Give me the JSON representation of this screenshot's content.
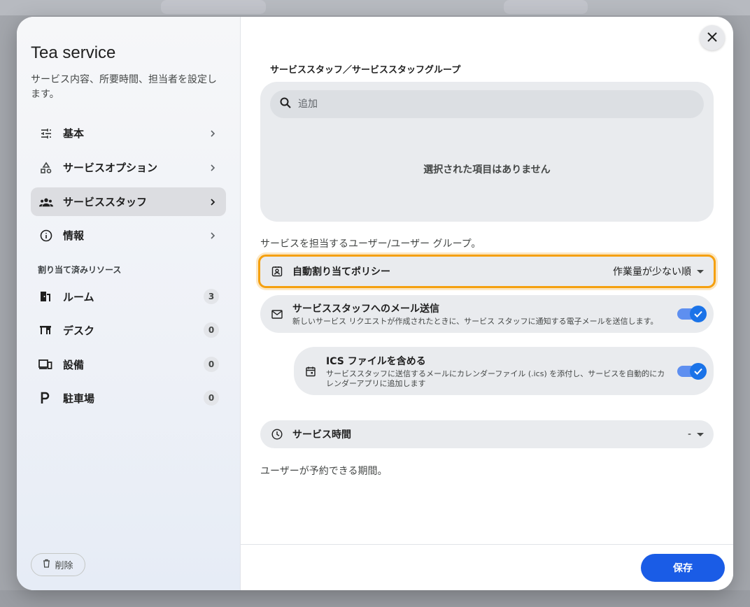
{
  "dialog": {
    "title": "Tea service",
    "description": "サービス内容、所要時間、担当者を設定します。"
  },
  "sidebar": {
    "nav": [
      {
        "label": "基本",
        "icon": "tune-icon"
      },
      {
        "label": "サービスオプション",
        "icon": "shapes-icon"
      },
      {
        "label": "サービススタッフ",
        "icon": "group-icon",
        "active": true
      },
      {
        "label": "情報",
        "icon": "info-icon"
      }
    ],
    "section_label": "割り当て済みリソース",
    "resources": [
      {
        "label": "ルーム",
        "count": "3",
        "icon": "door-icon"
      },
      {
        "label": "デスク",
        "count": "0",
        "icon": "desk-icon"
      },
      {
        "label": "設備",
        "count": "0",
        "icon": "devices-icon"
      },
      {
        "label": "駐車場",
        "count": "0",
        "icon": "parking-icon"
      }
    ],
    "delete_label": "削除"
  },
  "main": {
    "staff_heading": "サービススタッフ／サービススタッフグループ",
    "search_placeholder": "追加",
    "empty_message": "選択された項目はありません",
    "staff_caption": "サービスを担当するユーザー/ユーザー グループ。",
    "policy": {
      "label": "自動割り当てポリシー",
      "value": "作業量が少ない順"
    },
    "email": {
      "label": "サービススタッフへのメール送信",
      "sub": "新しいサービス リクエストが作成されたときに、サービス スタッフに通知する電子メールを送信します。",
      "enabled": true
    },
    "ics": {
      "label": "ICS ファイルを含める",
      "sub": "サービススタッフに送信するメールにカレンダーファイル (.ics) を添付し、サービスを自動的にカレンダーアプリに追加します",
      "enabled": true
    },
    "service_time": {
      "label": "サービス時間",
      "value": "-"
    },
    "time_caption": "ユーザーが予約できる期間。",
    "save_label": "保存"
  },
  "colors": {
    "accent": "#1a5ce6",
    "highlight": "#f5a00f"
  }
}
